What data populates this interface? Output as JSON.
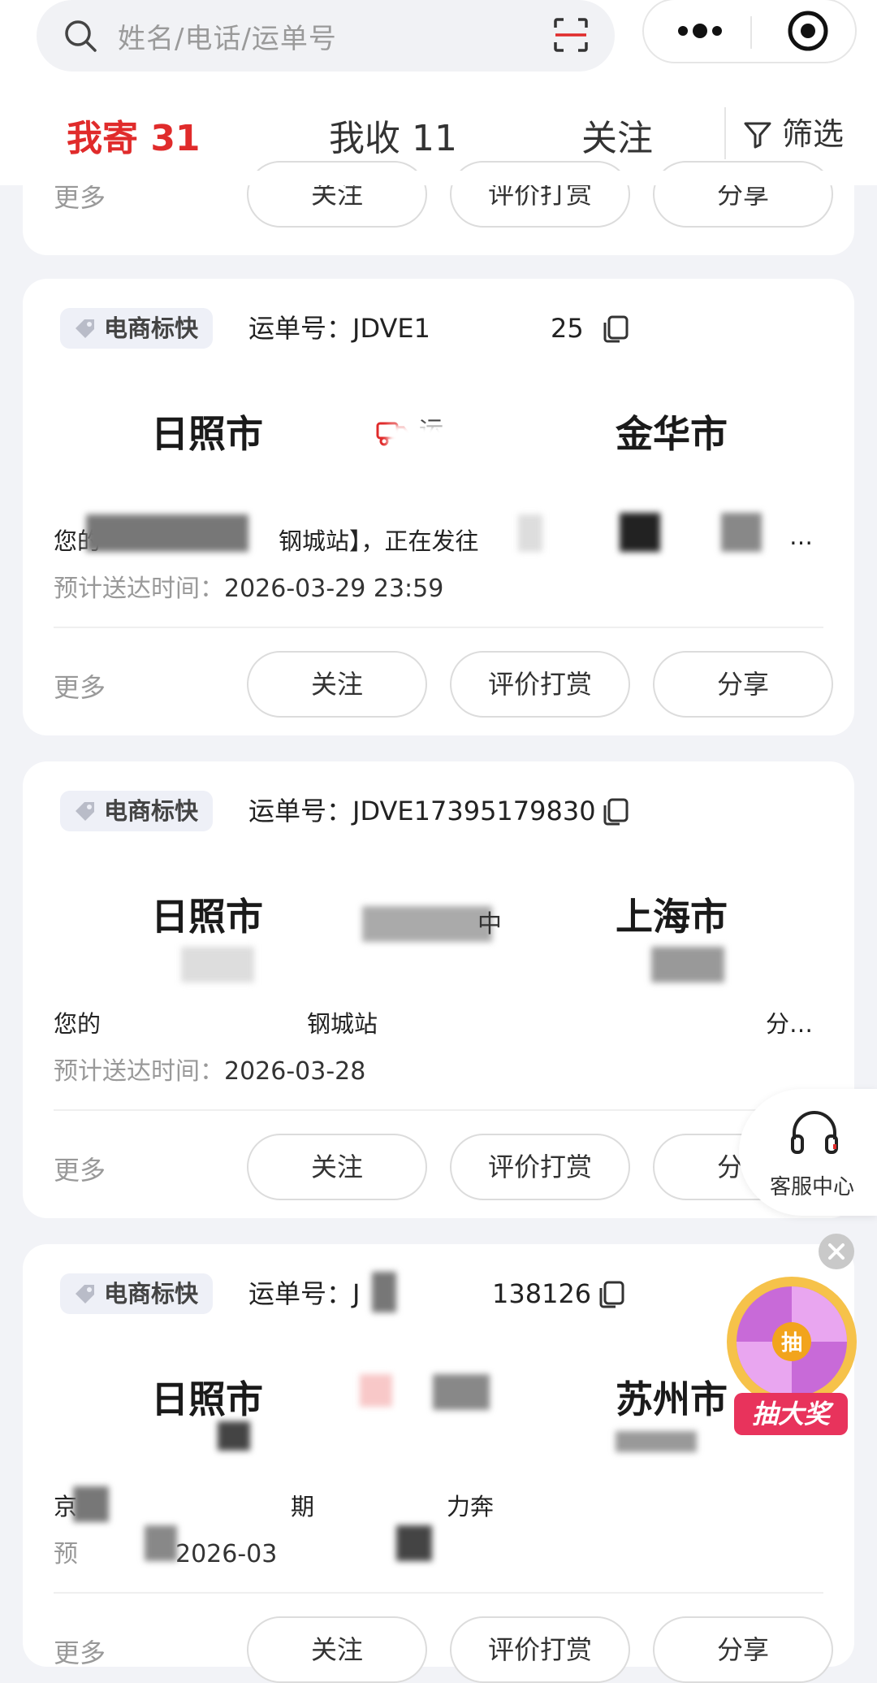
{
  "search": {
    "placeholder": "姓名/电话/运单号"
  },
  "tabs": [
    {
      "label": "我寄 31",
      "active": true
    },
    {
      "label": "我收 11",
      "active": false
    },
    {
      "label": "关注",
      "active": false
    }
  ],
  "filter_label": "筛选",
  "actions": {
    "more": "更多",
    "follow": "关注",
    "rate": "评价打赏",
    "share": "分享"
  },
  "cards": [
    {
      "badge": "电商标快",
      "waybill": "运单号：JDVE1",
      "waybill_tail": "25",
      "origin": "日照市",
      "status": "运",
      "dest": "金华市",
      "desc": "您的",
      "desc_mid": "钢城站】，正在发往",
      "desc_end": "…",
      "eta_label": "预计送达时间：",
      "eta": "2026-03-29 23:59"
    },
    {
      "badge": "电商标快",
      "waybill": "运单号：JDVE17395179830",
      "origin": "日照市",
      "status": "中",
      "dest": "上海市",
      "desc": "您的",
      "desc_mid": "钢城站",
      "desc_end": "分…",
      "eta_label": "预计送达时间：",
      "eta": "2026-03-28"
    },
    {
      "badge": "电商标快",
      "waybill": "运单号：J",
      "waybill_tail": "138126",
      "origin": "日照市",
      "dest": "苏州市",
      "desc": "京",
      "desc_mid": "期",
      "desc_end": "力奔",
      "eta_label": "预",
      "eta": "2026-03"
    }
  ],
  "customer_service": "客服中心",
  "promo": {
    "wheel_char": "抽",
    "label": "抽大奖"
  },
  "colors": {
    "accent": "#e02b2b",
    "promo": "#e8335c"
  }
}
